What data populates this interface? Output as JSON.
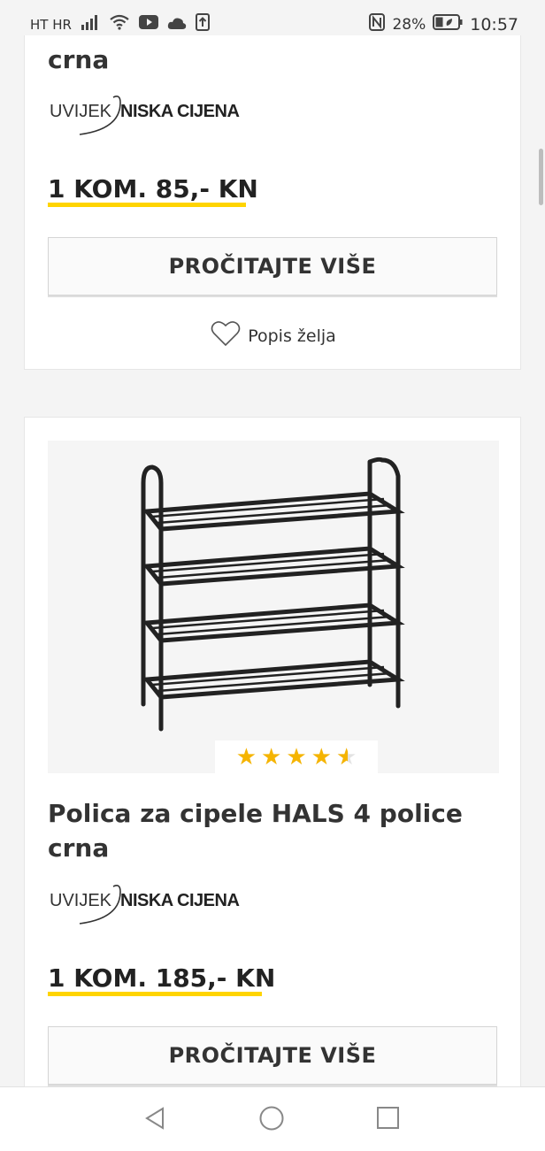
{
  "status_bar": {
    "carrier": "HT HR",
    "battery": "28%",
    "time": "10:57"
  },
  "products": [
    {
      "title_tail": "crna",
      "brand_left": "UVIJEK",
      "brand_right": "NISKA CIJENA",
      "price": "1 KOM. 85,- KN",
      "button": "PROČITAJTE VIŠE",
      "wishlist": "Popis želja"
    },
    {
      "title": "Polica za cipele HALS 4 police crna",
      "rating": 4.5,
      "brand_left": "UVIJEK",
      "brand_right": "NISKA CIJENA",
      "price": "1 KOM. 185,- KN",
      "button": "PROČITAJTE VIŠE"
    }
  ],
  "icons": {
    "signal": "signal-icon",
    "wifi": "wifi-icon",
    "youtube": "youtube-icon",
    "cloud": "cloud-icon",
    "upload": "upload-icon",
    "nfc": "nfc-icon",
    "battery": "battery-icon",
    "heart": "heart-icon",
    "back": "back-icon",
    "home": "home-icon",
    "recents": "recents-icon"
  },
  "colors": {
    "accent_underline": "#ffd400",
    "star": "#f5b400"
  }
}
